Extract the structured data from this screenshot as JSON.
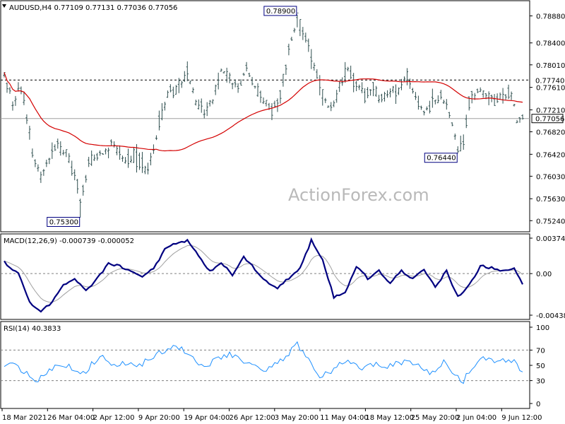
{
  "header": {
    "symbol": "AUDUSD,H4",
    "open": "0.77109",
    "high": "0.77131",
    "low": "0.77036",
    "close": "0.77056"
  },
  "watermark": "ActionForex.com",
  "colors": {
    "background": "#ffffff",
    "price_bars": "#2f4f4f",
    "moving_average": "#d40000",
    "macd_line": "#000080",
    "signal_line": "#a0a0a0",
    "rsi_line": "#1e90ff",
    "grid_dash": "#808080",
    "label_box": "#000080"
  },
  "x_axis": {
    "labels": [
      "18 Mar 2021",
      "26 Mar 04:00",
      "2 Apr 12:00",
      "9 Apr 20:00",
      "19 Apr 04:00",
      "26 Apr 12:00",
      "3 May 20:00",
      "11 May 04:00",
      "18 May 12:00",
      "25 May 20:00",
      "2 Jun 04:00",
      "9 Jun 12:00"
    ]
  },
  "chart_data": [
    {
      "panel": "price",
      "type": "ohlc-bar",
      "title": "AUDUSD,H4  0.77109 0.77131 0.77036 0.77056",
      "ylim": [
        0.7508,
        0.791
      ],
      "y_ticks": [
        "0.78880",
        "0.78400",
        "0.78010",
        "0.77610",
        "0.77210",
        "0.76820",
        "0.76420",
        "0.76030",
        "0.75630",
        "0.75240"
      ],
      "horizontal_levels": [
        {
          "label": "0.77740",
          "value": 0.7774,
          "style": "dashed"
        },
        {
          "label": "0.77056",
          "value": 0.77056,
          "style": "solid",
          "boxed": true
        }
      ],
      "annotations": [
        {
          "label": "0.78900",
          "x_index": 104,
          "value": 0.789,
          "position": "above-left"
        },
        {
          "label": "0.75300",
          "x_index": 27,
          "value": 0.753,
          "position": "below-left"
        },
        {
          "label": "0.76440",
          "x_index": 161,
          "value": 0.7644,
          "position": "below-left"
        }
      ],
      "anchors": [
        [
          0,
          0.7785
        ],
        [
          3,
          0.774
        ],
        [
          6,
          0.7755
        ],
        [
          10,
          0.765
        ],
        [
          13,
          0.76
        ],
        [
          16,
          0.764
        ],
        [
          19,
          0.766
        ],
        [
          22,
          0.764
        ],
        [
          25,
          0.761
        ],
        [
          27,
          0.756
        ],
        [
          30,
          0.763
        ],
        [
          34,
          0.764
        ],
        [
          38,
          0.7665
        ],
        [
          42,
          0.763
        ],
        [
          46,
          0.764
        ],
        [
          50,
          0.7615
        ],
        [
          53,
          0.764
        ],
        [
          55,
          0.77
        ],
        [
          58,
          0.7745
        ],
        [
          62,
          0.776
        ],
        [
          65,
          0.779
        ],
        [
          68,
          0.7735
        ],
        [
          71,
          0.772
        ],
        [
          74,
          0.774
        ],
        [
          77,
          0.779
        ],
        [
          80,
          0.7775
        ],
        [
          83,
          0.776
        ],
        [
          86,
          0.7795
        ],
        [
          89,
          0.776
        ],
        [
          92,
          0.774
        ],
        [
          95,
          0.772
        ],
        [
          98,
          0.775
        ],
        [
          101,
          0.783
        ],
        [
          104,
          0.788
        ],
        [
          107,
          0.785
        ],
        [
          110,
          0.78
        ],
        [
          113,
          0.775
        ],
        [
          116,
          0.772
        ],
        [
          119,
          0.776
        ],
        [
          122,
          0.7795
        ],
        [
          125,
          0.7765
        ],
        [
          128,
          0.7745
        ],
        [
          131,
          0.7765
        ],
        [
          134,
          0.774
        ],
        [
          137,
          0.7755
        ],
        [
          140,
          0.776
        ],
        [
          143,
          0.7775
        ],
        [
          146,
          0.7745
        ],
        [
          149,
          0.772
        ],
        [
          152,
          0.773
        ],
        [
          155,
          0.7745
        ],
        [
          158,
          0.7715
        ],
        [
          161,
          0.765
        ],
        [
          163,
          0.766
        ],
        [
          165,
          0.7735
        ],
        [
          168,
          0.7755
        ],
        [
          171,
          0.775
        ],
        [
          174,
          0.7735
        ],
        [
          177,
          0.7745
        ],
        [
          180,
          0.7755
        ],
        [
          182,
          0.77
        ],
        [
          184,
          0.771
        ]
      ],
      "bar_count": 185,
      "moving_average_period": 55
    },
    {
      "panel": "macd",
      "type": "line",
      "title": "MACD(12,26,9) -0.000739 -0.000052",
      "ylim": [
        -0.004389,
        0.003742
      ],
      "y_ticks": [
        "0.003742",
        "0.00",
        "-0.004389"
      ],
      "zero_line": 0,
      "series": [
        {
          "role": "main",
          "anchors": [
            [
              0,
              0.0012
            ],
            [
              5,
              0.0
            ],
            [
              9,
              -0.003
            ],
            [
              13,
              -0.004
            ],
            [
              17,
              -0.003
            ],
            [
              21,
              -0.0012
            ],
            [
              25,
              -0.0005
            ],
            [
              29,
              -0.0018
            ],
            [
              33,
              -0.0005
            ],
            [
              37,
              0.001
            ],
            [
              41,
              0.0008
            ],
            [
              45,
              0.0002
            ],
            [
              49,
              -0.0003
            ],
            [
              53,
              0.0005
            ],
            [
              57,
              0.0025
            ],
            [
              61,
              0.0032
            ],
            [
              65,
              0.0035
            ],
            [
              69,
              0.0018
            ],
            [
              73,
              0.0002
            ],
            [
              77,
              0.0012
            ],
            [
              81,
              -0.0002
            ],
            [
              85,
              0.0018
            ],
            [
              89,
              0.0005
            ],
            [
              93,
              -0.0008
            ],
            [
              97,
              -0.0015
            ],
            [
              101,
              -0.0005
            ],
            [
              105,
              0.0005
            ],
            [
              109,
              0.0035
            ],
            [
              113,
              0.0015
            ],
            [
              117,
              -0.0025
            ],
            [
              121,
              -0.002
            ],
            [
              125,
              0.0008
            ],
            [
              129,
              -0.0005
            ],
            [
              133,
              0.0003
            ],
            [
              137,
              -0.001
            ],
            [
              141,
              0.0003
            ],
            [
              145,
              -0.0005
            ],
            [
              149,
              0.0005
            ],
            [
              153,
              -0.0015
            ],
            [
              157,
              0.0003
            ],
            [
              161,
              -0.0025
            ],
            [
              165,
              -0.0012
            ],
            [
              169,
              0.0008
            ],
            [
              173,
              0.0006
            ],
            [
              177,
              0.0003
            ],
            [
              181,
              0.0005
            ],
            [
              184,
              -0.0012
            ]
          ]
        },
        {
          "role": "signal",
          "smoothing": 9
        }
      ]
    },
    {
      "panel": "rsi",
      "type": "line",
      "title": "RSI(14) 40.3833",
      "ylim": [
        0,
        100
      ],
      "y_ticks": [
        "100",
        "70",
        "50",
        "30",
        "0"
      ],
      "levels": [
        70,
        30
      ],
      "anchors": [
        [
          0,
          52
        ],
        [
          4,
          48
        ],
        [
          8,
          38
        ],
        [
          12,
          30
        ],
        [
          16,
          42
        ],
        [
          20,
          52
        ],
        [
          24,
          48
        ],
        [
          28,
          40
        ],
        [
          32,
          55
        ],
        [
          36,
          60
        ],
        [
          40,
          48
        ],
        [
          44,
          55
        ],
        [
          48,
          50
        ],
        [
          52,
          58
        ],
        [
          56,
          68
        ],
        [
          60,
          75
        ],
        [
          64,
          68
        ],
        [
          68,
          55
        ],
        [
          72,
          50
        ],
        [
          76,
          60
        ],
        [
          80,
          65
        ],
        [
          84,
          58
        ],
        [
          88,
          52
        ],
        [
          92,
          45
        ],
        [
          96,
          50
        ],
        [
          100,
          60
        ],
        [
          104,
          78
        ],
        [
          108,
          60
        ],
        [
          112,
          38
        ],
        [
          116,
          42
        ],
        [
          120,
          55
        ],
        [
          124,
          50
        ],
        [
          128,
          45
        ],
        [
          132,
          55
        ],
        [
          136,
          48
        ],
        [
          140,
          52
        ],
        [
          144,
          55
        ],
        [
          148,
          48
        ],
        [
          152,
          40
        ],
        [
          156,
          55
        ],
        [
          160,
          38
        ],
        [
          163,
          30
        ],
        [
          166,
          48
        ],
        [
          170,
          60
        ],
        [
          174,
          55
        ],
        [
          178,
          58
        ],
        [
          182,
          55
        ],
        [
          184,
          40
        ]
      ]
    }
  ]
}
